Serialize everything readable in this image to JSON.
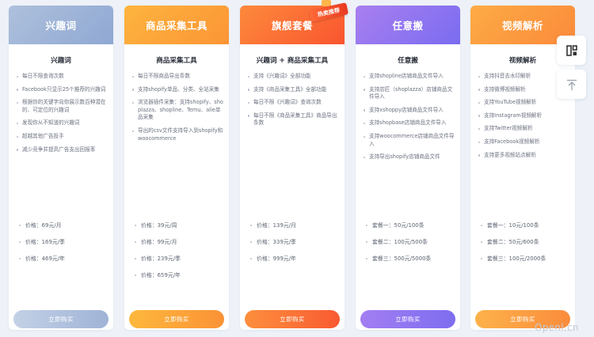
{
  "plans": [
    {
      "title": "兴趣词",
      "subtitle": "兴趣词",
      "features": [
        "每日不限查询次数",
        "Facebook只显示25个推荐的兴趣词",
        "根据你的关键字向你展示数百种潜在的、可定位的兴趣词",
        "发现你从不知道的兴趣词",
        "超越其他广告投手",
        "减少竞争并提高广告支出回报率"
      ],
      "prices": [
        "价格：69元/月",
        "价格：169元/季",
        "价格：469元/年"
      ],
      "button": "立即购买"
    },
    {
      "title": "商品采集工具",
      "subtitle": "商品采集工具",
      "features": [
        "每日不限商品导出条数",
        "支持shopify单品、分类、全站采集",
        "浏览器插件采集：支持shopify、shoplazza、shopline、Temu、alie单品采集",
        "导出的csv文件支持导入到shopify和woocommerce"
      ],
      "prices": [
        "价格：39元/周",
        "价格：99元/月",
        "价格：239元/季",
        "价格：659元/年"
      ],
      "button": "立即购买"
    },
    {
      "title": "旗舰套餐",
      "subtitle": "兴趣词 + 商品采集工具",
      "features": [
        "支持《兴趣词》全部功能",
        "支持《商品采集工具》全部功能",
        "每日不限《兴趣词》查询次数",
        "每日不限《商品采集工具》商品导出条数"
      ],
      "prices": [
        "价格：139元/月",
        "价格：339元/季",
        "价格：999元/年"
      ],
      "button": "立即购买",
      "badge": "热卖推荐"
    },
    {
      "title": "任意搬",
      "subtitle": "任意搬",
      "features": [
        "支持shopline店铺商品文件导入",
        "支持店匠（shoplazza）店铺商品文件导入",
        "支持xshoppy店铺商品文件导入",
        "支持shopbase店铺商品文件导入",
        "支持woocommerce店铺商品文件导入",
        "支持导出shopify店铺商品文件"
      ],
      "prices": [
        "套餐一：50元/100条",
        "套餐二：100元/500条",
        "套餐三：500元/5000条"
      ],
      "button": "立即购买"
    },
    {
      "title": "视频解析",
      "subtitle": "视频解析",
      "features": [
        "支持抖音去水印解析",
        "支持微博视频解析",
        "支持YouTube视频解析",
        "支持Instagram视频解析",
        "支持Twitter视频解析",
        "支持Facebook视频解析",
        "支持更多视频站点解析"
      ],
      "prices": [
        "套餐一：10元/100条",
        "套餐二：50元/600条",
        "套餐三：100元/2000条"
      ],
      "button": "立即购买"
    }
  ],
  "colors": {
    "interest": "#9fb4d8",
    "collect": "#fba63a",
    "flagship": "#fb6a3a",
    "move": "#8f72ee",
    "video": "#fc9845"
  },
  "side_buttons": [
    "layout-icon",
    "back-to-top-icon"
  ],
  "watermark": "Openl.cn"
}
